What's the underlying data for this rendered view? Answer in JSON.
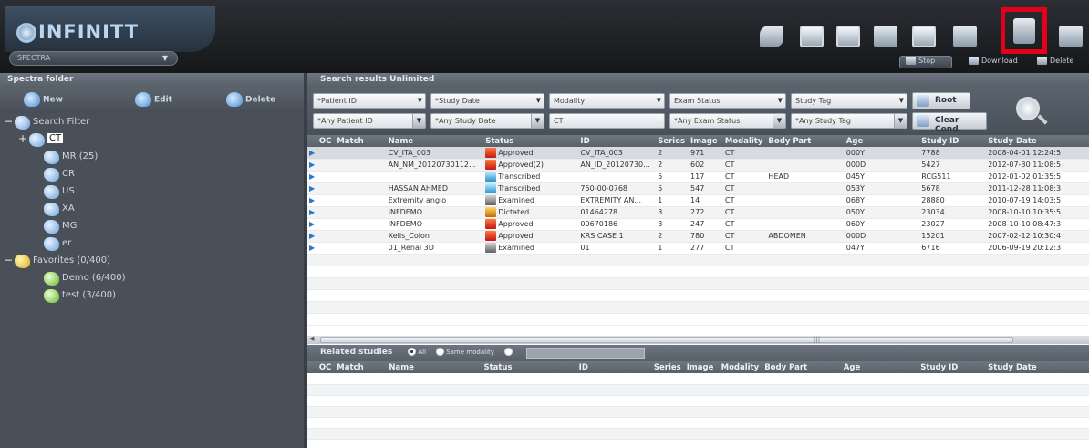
{
  "app": {
    "logo_text": "INFINITT",
    "spectra_select": "SPECTRA",
    "accent_highlight": "#e4001b"
  },
  "toolbar": {
    "icons": [
      "brush-tool-icon",
      "monitor-icon",
      "monitor-alt-icon",
      "film-icon",
      "monitor-person-icon",
      "folder-open-icon",
      "archive-box-icon",
      "hdd-icon"
    ],
    "stop_label": "Stop",
    "download_label": "Download",
    "delete_label": "Delete"
  },
  "left": {
    "title": "Spectra folder",
    "new_label": "New",
    "edit_label": "Edit",
    "delete_label": "Delete",
    "tree": [
      {
        "toggle": "−",
        "label": "Search Filter",
        "icon": "blue"
      },
      {
        "toggle": "+",
        "label": "CT",
        "icon": "blue",
        "selected": true
      },
      {
        "toggle": "",
        "label": "MR (25)",
        "icon": "blue"
      },
      {
        "toggle": "",
        "label": "CR",
        "icon": "blue"
      },
      {
        "toggle": "",
        "label": "US",
        "icon": "blue"
      },
      {
        "toggle": "",
        "label": "XA",
        "icon": "blue"
      },
      {
        "toggle": "",
        "label": "MG",
        "icon": "blue"
      },
      {
        "toggle": "",
        "label": "er",
        "icon": "blue"
      },
      {
        "toggle": "−",
        "label": "Favorites (0/400)",
        "icon": "star"
      },
      {
        "toggle": "",
        "label": "Demo (6/400)",
        "icon": "green"
      },
      {
        "toggle": "",
        "label": "test (3/400)",
        "icon": "green"
      }
    ]
  },
  "search": {
    "title": "Search results  Unlimited",
    "filter_headers": [
      "*Patient ID",
      "*Study Date",
      "Modality",
      "Exam Status",
      "Study Tag"
    ],
    "filter_values": [
      "*Any Patient ID",
      "*Any Study Date",
      "CT",
      "*Any Exam Status",
      "*Any Study Tag"
    ],
    "root_label": "Root",
    "clear_label": "Clear Cond.",
    "columns": [
      "",
      "OC",
      "Match",
      "Name",
      "Status",
      "ID",
      "Series",
      "Image",
      "Modality",
      "Body Part",
      "Age",
      "Study ID",
      "Study Date"
    ],
    "rows": [
      {
        "name": "CV_ITA_003",
        "status": "Approved",
        "status_type": "approved",
        "id": "CV_ITA_003",
        "series": "2",
        "image": "971",
        "modality": "CT",
        "body": "",
        "age": "000Y",
        "study_id": "7788",
        "date": "2008-04-01 12:24:5"
      },
      {
        "name": "AN_NM_20120730112...",
        "status": "Approved(2)",
        "status_type": "approved",
        "id": "AN_ID_20120730...",
        "series": "2",
        "image": "602",
        "modality": "CT",
        "body": "",
        "age": "000D",
        "study_id": "5427",
        "date": "2012-07-30 11:08:5"
      },
      {
        "name": "",
        "status": "Transcribed",
        "status_type": "transcribed",
        "id": "",
        "series": "5",
        "image": "117",
        "modality": "CT",
        "body": "HEAD",
        "age": "045Y",
        "study_id": "RCG511",
        "date": "2012-01-02 01:35:5"
      },
      {
        "name": "HASSAN AHMED",
        "status": "Transcribed",
        "status_type": "transcribed",
        "id": "750-00-0768",
        "series": "5",
        "image": "547",
        "modality": "CT",
        "body": "",
        "age": "053Y",
        "study_id": "5678",
        "date": "2011-12-28 11:08:3"
      },
      {
        "name": "Extremity angio",
        "status": "Examined",
        "status_type": "examined",
        "id": "EXTREMITY AN...",
        "series": "1",
        "image": "14",
        "modality": "CT",
        "body": "",
        "age": "068Y",
        "study_id": "28880",
        "date": "2010-07-19 14:03:5"
      },
      {
        "name": "INFDEMO",
        "status": "Dictated",
        "status_type": "dictated",
        "id": "01464278",
        "series": "3",
        "image": "272",
        "modality": "CT",
        "body": "",
        "age": "050Y",
        "study_id": "23034",
        "date": "2008-10-10 10:35:5"
      },
      {
        "name": "INFDEMO",
        "status": "Approved",
        "status_type": "approved",
        "id": "00670186",
        "series": "3",
        "image": "247",
        "modality": "CT",
        "body": "",
        "age": "060Y",
        "study_id": "23027",
        "date": "2008-10-10 08:47:3"
      },
      {
        "name": "Xelis_Colon",
        "status": "Approved",
        "status_type": "approved",
        "id": "KRS CASE 1",
        "series": "2",
        "image": "780",
        "modality": "CT",
        "body": "ABDOMEN",
        "age": "000D",
        "study_id": "15201",
        "date": "2007-02-12 10:30:4"
      },
      {
        "name": "01_Renal 3D",
        "status": "Examined",
        "status_type": "examined",
        "id": "01",
        "series": "1",
        "image": "277",
        "modality": "CT",
        "body": "",
        "age": "047Y",
        "study_id": "6716",
        "date": "2006-09-19 20:12:3"
      }
    ]
  },
  "related": {
    "title": "Related studies",
    "opt_all": "All",
    "opt_same": "Same modality",
    "columns": [
      "",
      "OC",
      "Match",
      "Name",
      "Status",
      "ID",
      "Series",
      "Image",
      "Modality",
      "Body Part",
      "Age",
      "Study ID",
      "Study Date"
    ]
  }
}
